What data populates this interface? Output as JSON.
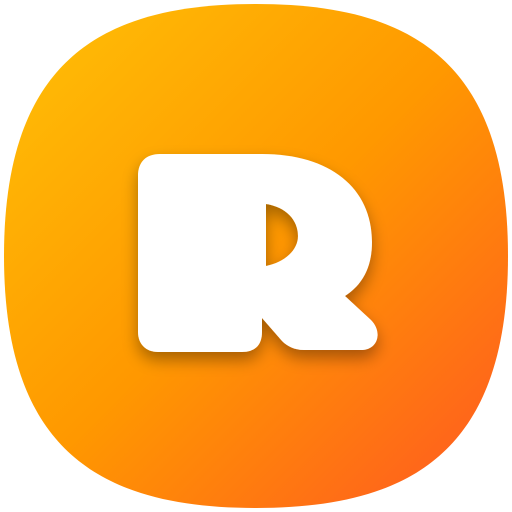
{
  "icon": {
    "name": "app-icon",
    "glyph": "R",
    "colors": {
      "gradient_start": "#FFC107",
      "gradient_mid": "#FF9800",
      "gradient_end": "#FF5722",
      "letter": "#FFFFFF",
      "shadow": "#9A3A00"
    }
  }
}
